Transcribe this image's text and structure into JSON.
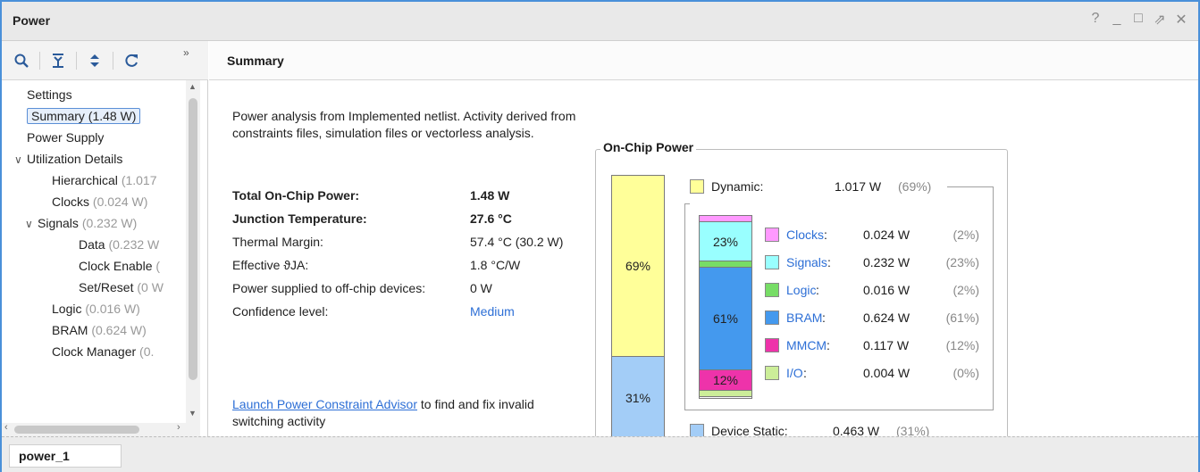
{
  "window": {
    "title": "Power",
    "controls": [
      "?",
      "_",
      "□",
      "⇗",
      "✕"
    ]
  },
  "toolbar": {
    "search_icon": "⌕",
    "collapse_icon": "⇊",
    "expand_icon": "⇕",
    "refresh_icon": "↻",
    "more_icon": "»"
  },
  "tree": {
    "items": [
      {
        "label": "Settings",
        "value": "",
        "indent": 0,
        "chev": ""
      },
      {
        "label": "Summary (1.48 W)",
        "value": "",
        "indent": 0,
        "chev": "",
        "selected": true
      },
      {
        "label": "Power Supply",
        "value": "",
        "indent": 0,
        "chev": ""
      },
      {
        "label": "Utilization Details",
        "value": "",
        "indent": 0,
        "chev": "v"
      },
      {
        "label": "Hierarchical ",
        "value": "(1.017",
        "indent": 2,
        "chev": ""
      },
      {
        "label": "Clocks ",
        "value": "(0.024 W)",
        "indent": 2,
        "chev": ""
      },
      {
        "label": "Signals ",
        "value": "(0.232 W)",
        "indent": 1,
        "chev": "v"
      },
      {
        "label": "Data ",
        "value": "(0.232 W",
        "indent": 3,
        "chev": ""
      },
      {
        "label": "Clock Enable ",
        "value": "(",
        "indent": 3,
        "chev": ""
      },
      {
        "label": "Set/Reset ",
        "value": "(0 W",
        "indent": 3,
        "chev": ""
      },
      {
        "label": "Logic ",
        "value": "(0.016 W)",
        "indent": 2,
        "chev": ""
      },
      {
        "label": "BRAM ",
        "value": "(0.624 W)",
        "indent": 2,
        "chev": ""
      },
      {
        "label": "Clock Manager ",
        "value": "(0.",
        "indent": 2,
        "chev": ""
      }
    ]
  },
  "summary": {
    "heading": "Summary",
    "description": "Power analysis from Implemented netlist. Activity derived from constraints files, simulation files or vectorless analysis.",
    "rows": [
      {
        "label": "Total On-Chip Power:",
        "value": "1.48 W",
        "bold": true
      },
      {
        "label": "Junction Temperature:",
        "value": "27.6 °C",
        "bold": true
      },
      {
        "label": "Thermal Margin:",
        "value": "57.4 °C (30.2 W)",
        "bold": false
      },
      {
        "label": "Effective ϑJA:",
        "value": "1.8 °C/W",
        "bold": false
      },
      {
        "label": "Power supplied to off-chip devices:",
        "value": "0 W",
        "bold": false
      },
      {
        "label": "Confidence level:",
        "value": "Medium",
        "bold": false,
        "link": true
      }
    ],
    "advisor_link": "Launch Power Constraint Advisor",
    "advisor_text": " to find and fix invalid switching activity"
  },
  "onchip": {
    "title": "On-Chip Power",
    "dynamic": {
      "name": "Dynamic:",
      "value": "1.017 W",
      "pct": "(69%)",
      "bar_label": "69%",
      "share": 0.69,
      "color": "#ffff99"
    },
    "static": {
      "name": "Device Static:",
      "value": "0.463 W",
      "pct": "(31%)",
      "bar_label": "31%",
      "share": 0.31,
      "color": "#a3cdf7"
    },
    "components": [
      {
        "name": "Clocks",
        "value": "0.024 W",
        "pct": "(2%)",
        "bar_label": "",
        "share": 0.02,
        "color": "#ff99ff"
      },
      {
        "name": "Signals",
        "value": "0.232 W",
        "pct": "(23%)",
        "bar_label": "23%",
        "share": 0.23,
        "color": "#99ffff"
      },
      {
        "name": "Logic",
        "value": "0.016 W",
        "pct": "(2%)",
        "bar_label": "",
        "share": 0.02,
        "color": "#77dd66"
      },
      {
        "name": "BRAM",
        "value": "0.624 W",
        "pct": "(61%)",
        "bar_label": "61%",
        "share": 0.61,
        "color": "#4499ee"
      },
      {
        "name": "MMCM",
        "value": "0.117 W",
        "pct": "(12%)",
        "bar_label": "12%",
        "share": 0.12,
        "color": "#ee33aa"
      },
      {
        "name": "I/O",
        "value": "0.004 W",
        "pct": "(0%)",
        "bar_label": "",
        "share": 0.0,
        "color": "#ccee99"
      }
    ]
  },
  "bottom": {
    "tab_label": "power_1"
  }
}
